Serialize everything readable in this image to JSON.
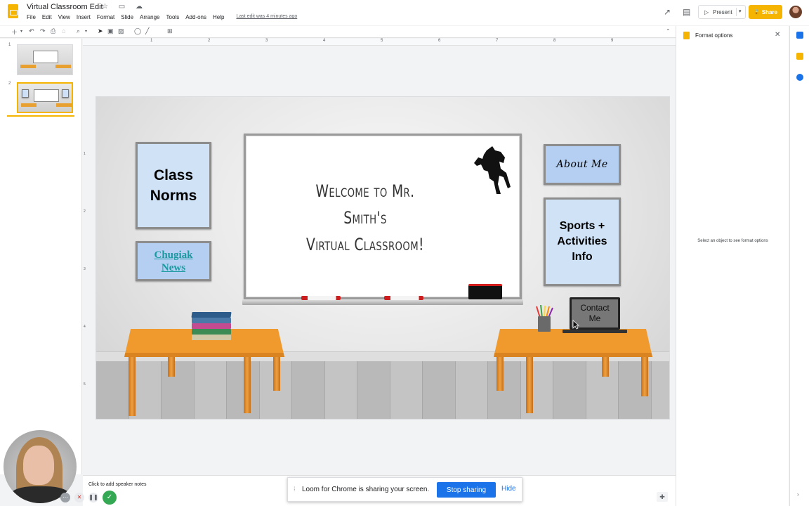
{
  "app": {
    "doc_title": "Virtual Classroom Edit",
    "last_edit": "Last edit was 4 minutes ago",
    "menu": [
      "File",
      "Edit",
      "View",
      "Insert",
      "Format",
      "Slide",
      "Arrange",
      "Tools",
      "Add-ons",
      "Help"
    ],
    "present_label": "Present",
    "share_label": "Share",
    "accent_color": "#f4b400"
  },
  "filmstrip": {
    "slides": [
      {
        "number": "1",
        "selected": false
      },
      {
        "number": "2",
        "selected": true
      }
    ]
  },
  "ruler": {
    "top_marks": [
      "1",
      "2",
      "3",
      "4",
      "5",
      "6",
      "7",
      "8",
      "9"
    ],
    "side_marks": [
      "1",
      "2",
      "3",
      "4",
      "5"
    ]
  },
  "slide": {
    "board_title_line1": "Welcome to Mr. Smith's",
    "board_title_line2": "Virtual Classroom!",
    "class_norms_line1": "Class",
    "class_norms_line2": "Norms",
    "news_line1": "Chugiak",
    "news_line2": "News",
    "about_me": "About Me",
    "sports_line1": "Sports +",
    "sports_line2": "Activities",
    "sports_line3": "Info",
    "contact_line1": "Contact",
    "contact_line2": "Me"
  },
  "notes": {
    "placeholder": "Click to add speaker notes"
  },
  "format_panel": {
    "title": "Format options",
    "hint": "Select an object to see format options"
  },
  "loom": {
    "message": "Loom for Chrome is sharing your screen.",
    "stop_label": "Stop sharing",
    "hide_label": "Hide",
    "stop_color": "#1a73e8"
  },
  "icons": {
    "star": "☆",
    "move_to_folder": "▭",
    "cloud": "☁",
    "trend": "↗",
    "comments": "▤",
    "lock": "🔒",
    "close": "✕",
    "collapse": "⌃"
  }
}
